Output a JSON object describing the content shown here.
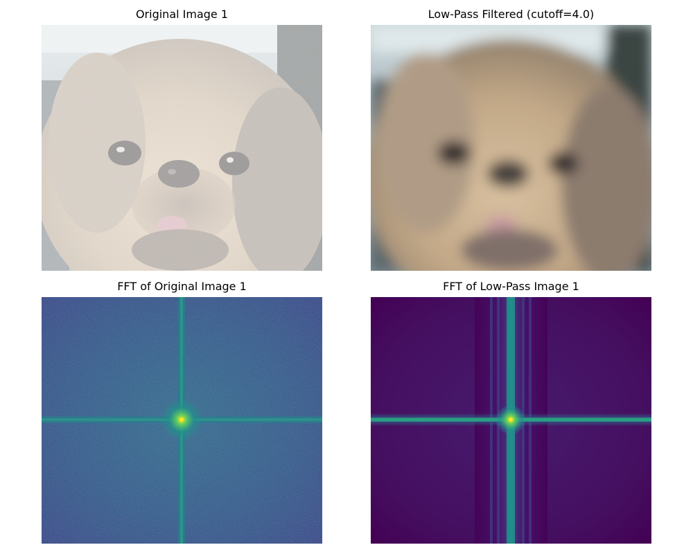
{
  "figure": {
    "panels": [
      {
        "id": "original",
        "title": "Original Image 1",
        "content": "photo of a small long-haired tan dog face, sharp"
      },
      {
        "id": "lowpass",
        "title": "Low-Pass Filtered (cutoff=4.0)",
        "content": "same dog photo, heavily blurred"
      },
      {
        "id": "fft_original",
        "title": "FFT of Original Image 1",
        "content": "log-magnitude spectrum, viridis colormap, noisy blue-teal field with bright center and cross"
      },
      {
        "id": "fft_lowpass",
        "title": "FFT of Low-Pass Image 1",
        "content": "log-magnitude spectrum, viridis colormap, dark purple with bright center and banded cross"
      }
    ],
    "colors": {
      "viridis_dark": "#440154",
      "viridis_purple": "#47186a",
      "viridis_blue": "#3b528b",
      "viridis_teal": "#21918c",
      "viridis_green": "#5ec962",
      "viridis_yellow": "#fde725"
    }
  }
}
